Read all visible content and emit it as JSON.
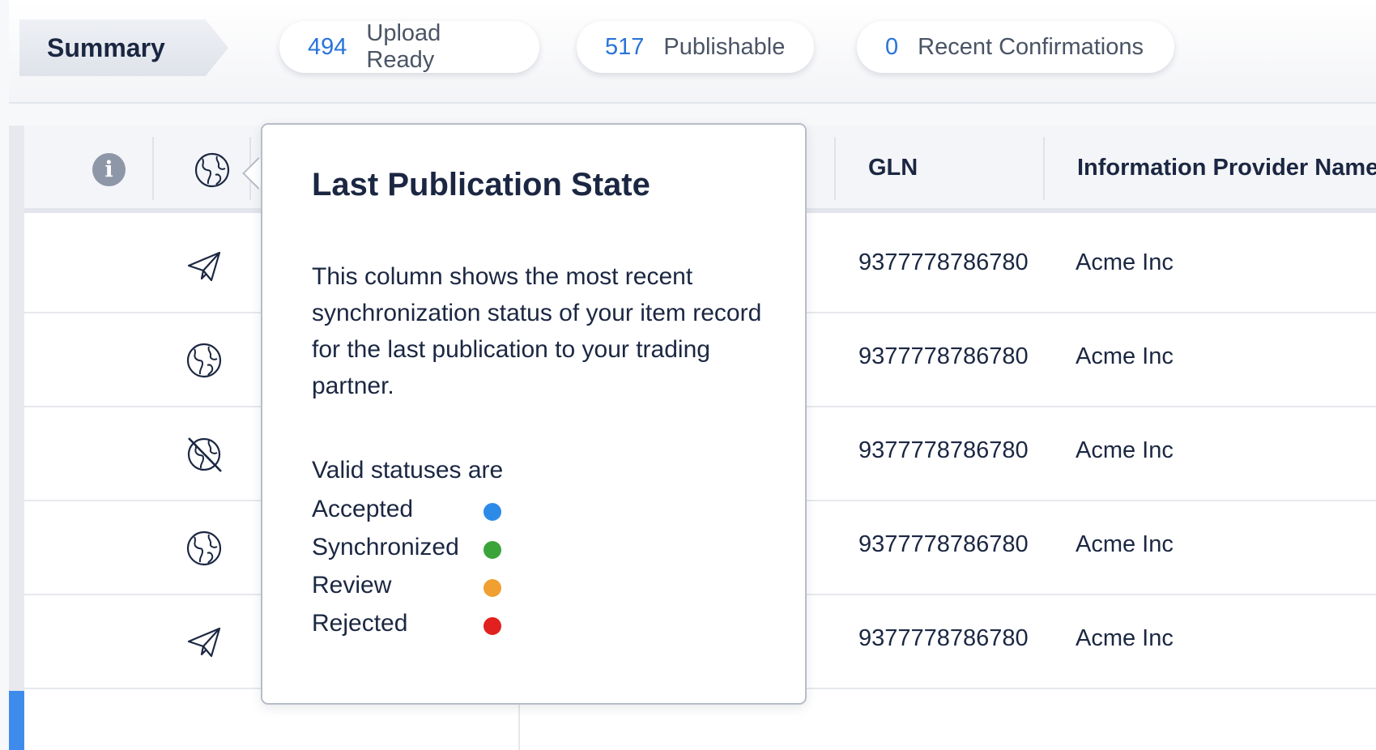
{
  "summary": {
    "title": "Summary",
    "pills": [
      {
        "count": "494",
        "label": "Upload Ready"
      },
      {
        "count": "517",
        "label": "Publishable"
      },
      {
        "count": "0",
        "label": "Recent Confirmations"
      }
    ]
  },
  "grid": {
    "header": {
      "info_icon": "info-icon",
      "publication_icon": "globe-icon",
      "gln_label": "GLN",
      "provider_label": "Information Provider Name"
    },
    "rows": [
      {
        "status_icon": "paper-plane-icon",
        "gln": "9377778786780",
        "provider": "Acme Inc"
      },
      {
        "status_icon": "globe-icon",
        "gln": "9377778786780",
        "provider": "Acme Inc"
      },
      {
        "status_icon": "globe-crossed-icon",
        "gln": "9377778786780",
        "provider": "Acme Inc"
      },
      {
        "status_icon": "globe-icon",
        "gln": "9377778786780",
        "provider": "Acme Inc"
      },
      {
        "status_icon": "paper-plane-icon",
        "gln": "9377778786780",
        "provider": "Acme Inc"
      }
    ]
  },
  "tooltip": {
    "title": "Last Publication State",
    "description": "This column shows the most recent synchronization status of your item record for the last publication to your trading partner.",
    "statuses_heading": "Valid statuses are",
    "statuses": [
      {
        "label": "Accepted",
        "color": "#2d8be8"
      },
      {
        "label": "Synchronized",
        "color": "#3aa43a"
      },
      {
        "label": "Review",
        "color": "#f0a030"
      },
      {
        "label": "Rejected",
        "color": "#e0211f"
      }
    ]
  },
  "colors": {
    "accent": "#2874d8",
    "selection_bar": "#3d8cec",
    "text": "#1b2742"
  }
}
